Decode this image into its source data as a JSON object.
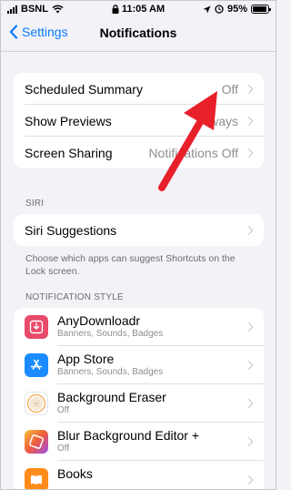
{
  "status_bar": {
    "carrier": "BSNL",
    "time": "11:05 AM",
    "battery": "95%",
    "battery_level": 0.95,
    "icons": [
      "signal-icon",
      "wifi-icon",
      "lock-icon",
      "location-icon",
      "alarm-icon",
      "battery-icon"
    ]
  },
  "nav": {
    "back_label": "Settings",
    "title": "Notifications"
  },
  "settings": [
    {
      "label": "Scheduled Summary",
      "value": "Off"
    },
    {
      "label": "Show Previews",
      "value": "Always"
    },
    {
      "label": "Screen Sharing",
      "value": "Notifications Off"
    }
  ],
  "siri": {
    "header": "SIRI",
    "row_label": "Siri Suggestions",
    "footnote": "Choose which apps can suggest Shortcuts on the Lock screen."
  },
  "notification_style": {
    "header": "NOTIFICATION STYLE",
    "apps": [
      {
        "name": "AnyDownloadr",
        "detail": "Banners, Sounds, Badges",
        "icon": "anydownloadr-icon",
        "color": "#e84a6a"
      },
      {
        "name": "App Store",
        "detail": "Banners, Sounds, Badges",
        "icon": "app-store-icon",
        "color": "#1a8cff"
      },
      {
        "name": "Background Eraser",
        "detail": "Off",
        "icon": "background-eraser-icon",
        "color": "#ffffff"
      },
      {
        "name": "Blur Background Editor +",
        "detail": "Off",
        "icon": "blur-editor-icon",
        "color": "#f05a3c"
      },
      {
        "name": "Books",
        "detail": "",
        "icon": "books-icon",
        "color": "#ff8c1a"
      }
    ]
  },
  "annotation": {
    "color": "#e8202a"
  }
}
